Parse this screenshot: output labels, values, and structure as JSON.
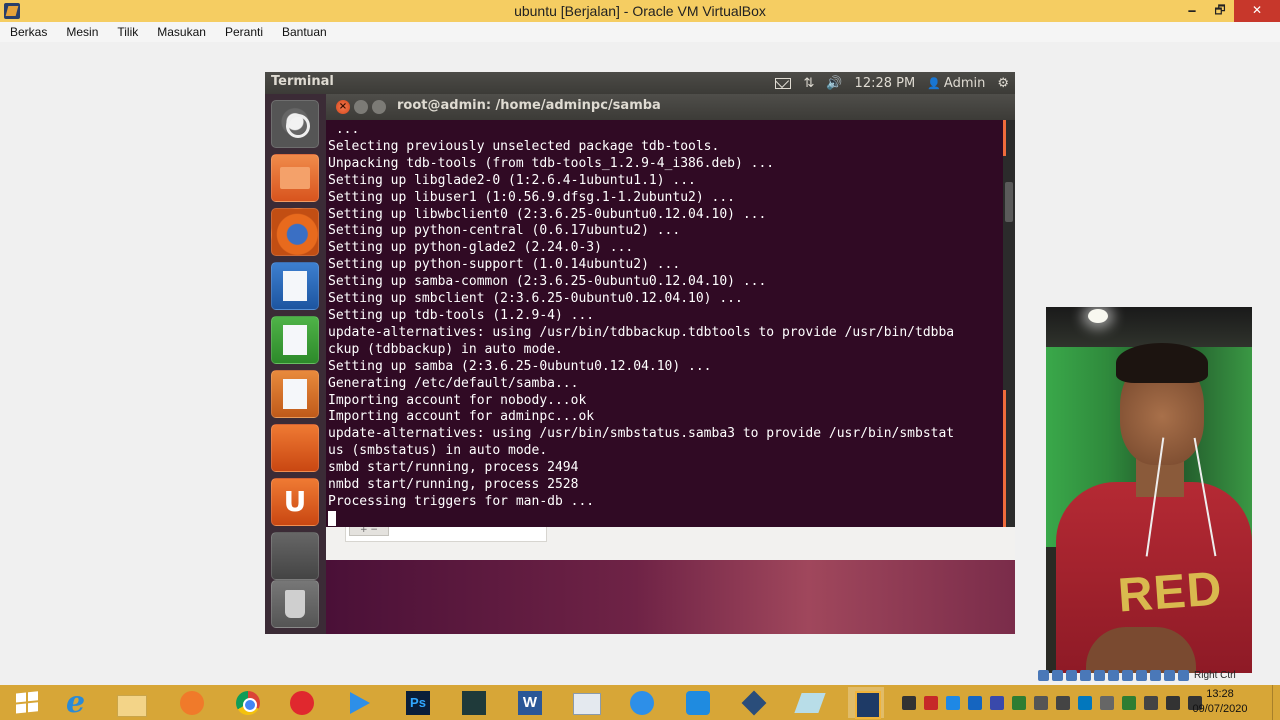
{
  "host_window": {
    "title": "ubuntu [Berjalan] - Oracle VM VirtualBox",
    "controls": {
      "minimize": "🗕",
      "restore": "🗗",
      "close": "✕"
    },
    "menu": [
      "Berkas",
      "Mesin",
      "Tilik",
      "Masukan",
      "Peranti",
      "Bantuan"
    ],
    "host_key_label": "Right Ctrl"
  },
  "guest_panel": {
    "app_name": "Terminal",
    "clock": "12:28 PM",
    "user": "Admin",
    "network_glyph": "⇅",
    "volume_glyph": "🔊",
    "user_glyph": "👤",
    "gear_glyph": "⚙"
  },
  "launcher": {
    "items": [
      "dash-home",
      "files",
      "firefox",
      "libreoffice-writer",
      "libreoffice-calc",
      "libreoffice-impress",
      "software-center",
      "ubuntu-one",
      "system-settings",
      "trash"
    ],
    "ubuntu_one_letter": "U"
  },
  "terminal": {
    "title": "root@admin: /home/adminpc/samba",
    "close_glyph": "×",
    "lines": [
      " ...",
      "Selecting previously unselected package tdb-tools.",
      "Unpacking tdb-tools (from tdb-tools_1.2.9-4_i386.deb) ...",
      "Setting up libglade2-0 (1:2.6.4-1ubuntu1.1) ...",
      "Setting up libuser1 (1:0.56.9.dfsg.1-1.2ubuntu2) ...",
      "Setting up libwbclient0 (2:3.6.25-0ubuntu0.12.04.10) ...",
      "Setting up python-central (0.6.17ubuntu2) ...",
      "Setting up python-glade2 (2.24.0-3) ...",
      "Setting up python-support (1.0.14ubuntu2) ...",
      "Setting up samba-common (2:3.6.25-0ubuntu0.12.04.10) ...",
      "Setting up smbclient (2:3.6.25-0ubuntu0.12.04.10) ...",
      "Setting up tdb-tools (1.2.9-4) ...",
      "update-alternatives: using /usr/bin/tdbbackup.tdbtools to provide /usr/bin/tdbba",
      "ckup (tdbbackup) in auto mode.",
      "Setting up samba (2:3.6.25-0ubuntu0.12.04.10) ...",
      "Generating /etc/default/samba...",
      "Importing account for nobody...ok",
      "Importing account for adminpc...ok",
      "update-alternatives: using /usr/bin/smbstatus.samba3 to provide /usr/bin/smbstat",
      "us (smbstatus) in auto mode.",
      "smbd start/running, process 2494",
      "nmbd start/running, process 2528",
      "Processing triggers for man-db ..."
    ]
  },
  "webcam": {
    "shirt_text": "RED"
  },
  "taskbar": {
    "apps": [
      "start",
      "internet-explorer",
      "file-explorer",
      "uc-browser",
      "chrome",
      "acrobat",
      "media-player",
      "photoshop",
      "sketchup",
      "word",
      "mail",
      "sync",
      "screen-capture",
      "virtualbox-3d",
      "paper",
      "virtualbox"
    ],
    "clock_time": "13:28",
    "clock_date": "09/07/2020"
  },
  "colors": {
    "vbox_title": "#f5cd62",
    "terminal_bg": "#300a24",
    "taskbar": "#d7a637",
    "ubuntu_orange": "#e95420"
  }
}
